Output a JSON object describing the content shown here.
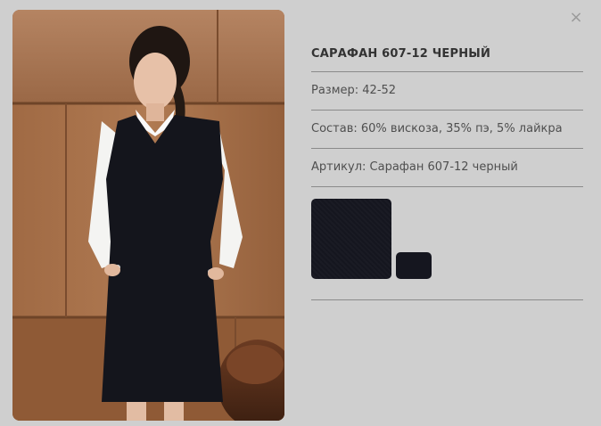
{
  "close": {
    "icon": "close-icon",
    "glyph": "×"
  },
  "product": {
    "title": "САРАФАН 607-12 ЧЕРНЫЙ",
    "size": "Размер: 42-52",
    "composition": "Состав: 60% вискоза, 35% пэ, 5% лайкра",
    "article": "Артикул: Сарафан 607-12 черный"
  },
  "swatches": [
    {
      "name": "black-fabric",
      "color": "#15161f"
    },
    {
      "name": "black-fabric",
      "color": "#15161f"
    }
  ]
}
